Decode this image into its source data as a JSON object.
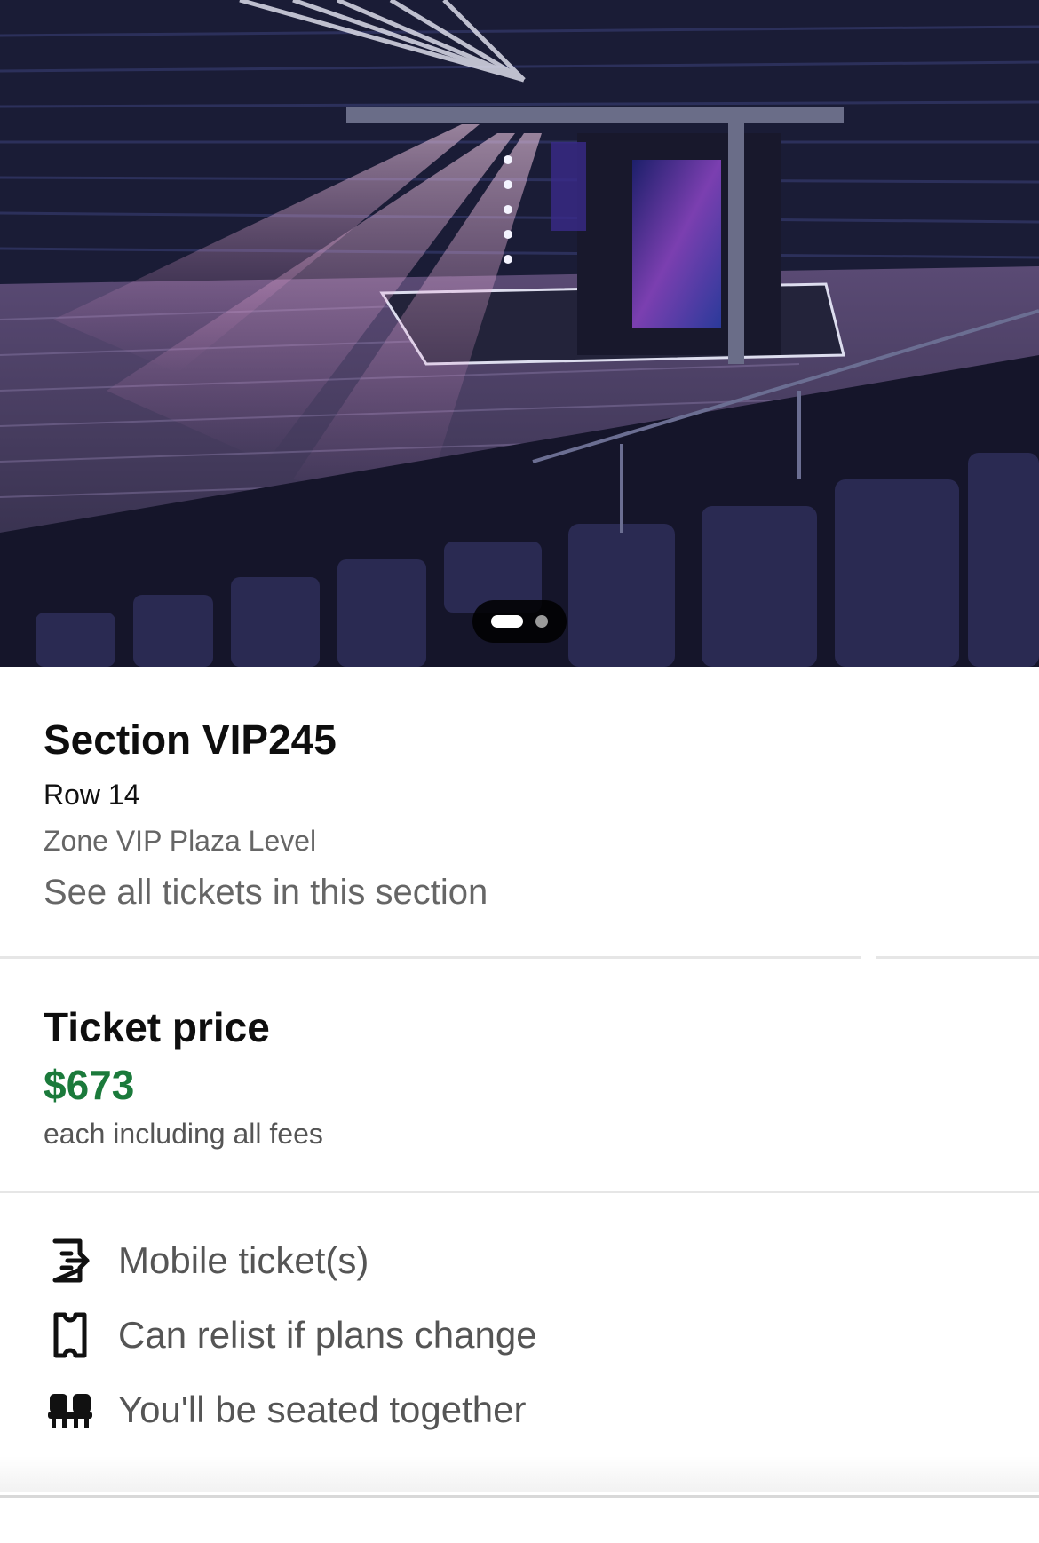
{
  "hero": {
    "image_icon": "venue-view-image",
    "pagination": {
      "count": 2,
      "active": 1
    }
  },
  "section": {
    "title": "Section VIP245",
    "row": "Row 14",
    "zone": "Zone VIP Plaza Level",
    "see_all": "See all tickets in this section"
  },
  "price": {
    "title": "Ticket price",
    "amount": "$673",
    "note": "each including all fees",
    "accent_color": "#1b7a3b"
  },
  "features": [
    {
      "icon": "mobile-ticket-icon",
      "label": "Mobile ticket(s)"
    },
    {
      "icon": "ticket-relist-icon",
      "label": "Can relist if plans change"
    },
    {
      "icon": "seats-together-icon",
      "label": "You'll be seated together"
    }
  ]
}
